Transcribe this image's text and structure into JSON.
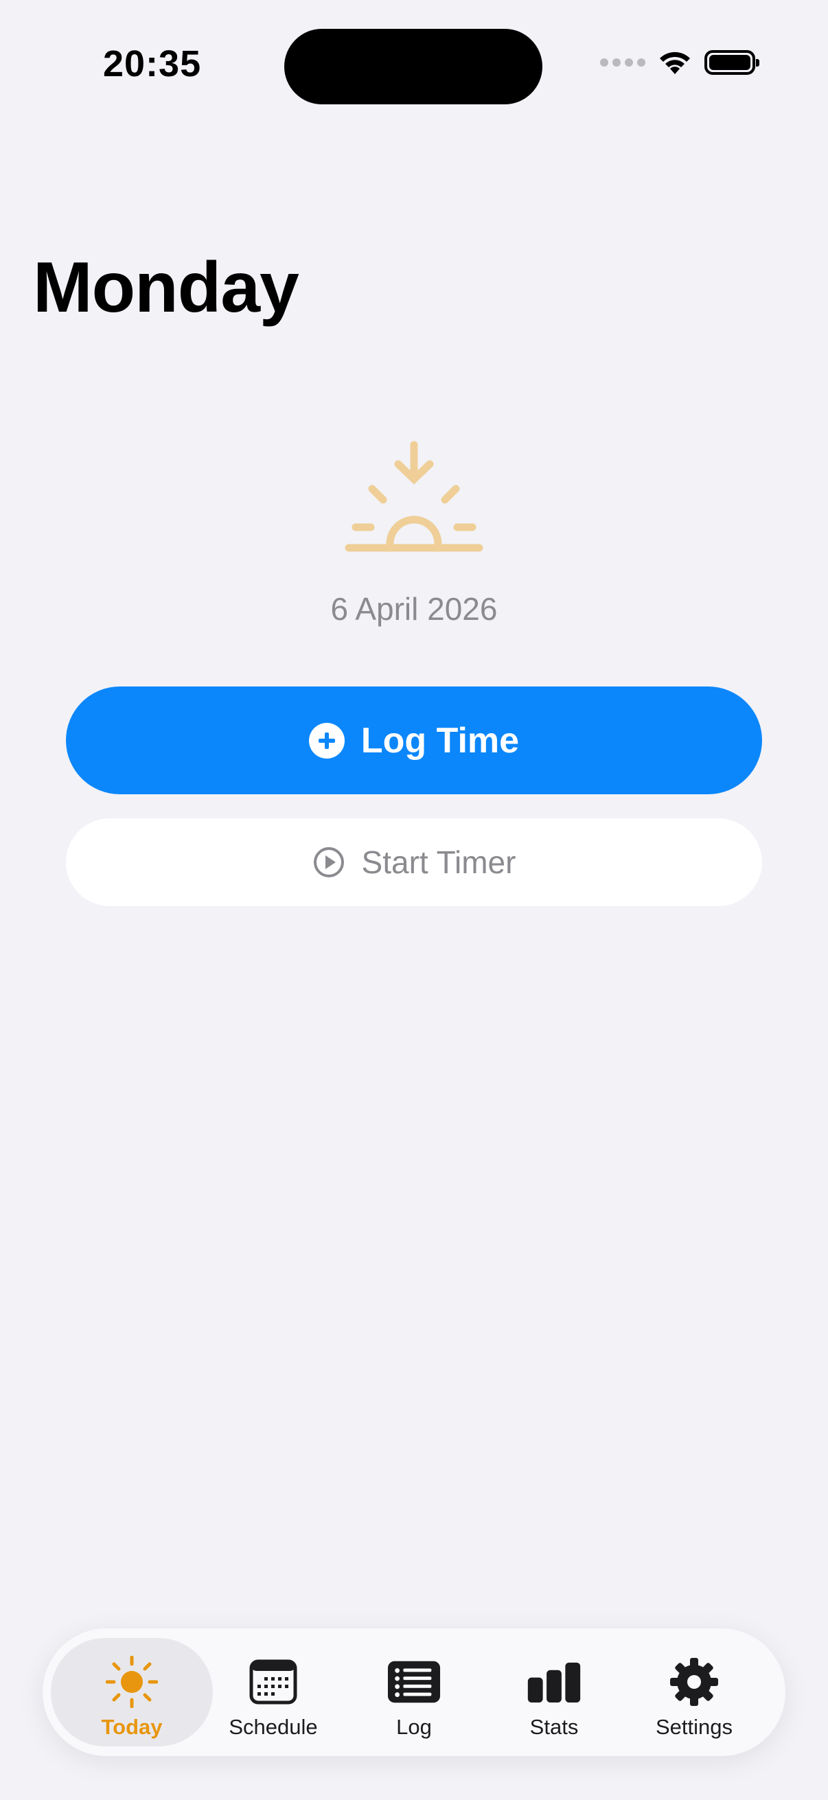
{
  "status_bar": {
    "time": "20:35"
  },
  "header": {
    "title": "Monday"
  },
  "main": {
    "date": "6 April 2026",
    "icon": "sunrise-icon",
    "icon_color": "#efcf97",
    "log_time_label": "Log Time",
    "start_timer_label": "Start Timer"
  },
  "colors": {
    "accent_blue": "#0b87fb",
    "active_tab": "#e8960f",
    "background": "#f2f2f7"
  },
  "tabs": [
    {
      "label": "Today",
      "icon": "sun-icon",
      "active": true
    },
    {
      "label": "Schedule",
      "icon": "calendar-icon",
      "active": false
    },
    {
      "label": "Log",
      "icon": "list-icon",
      "active": false
    },
    {
      "label": "Stats",
      "icon": "bar-chart-icon",
      "active": false
    },
    {
      "label": "Settings",
      "icon": "gear-icon",
      "active": false
    }
  ]
}
